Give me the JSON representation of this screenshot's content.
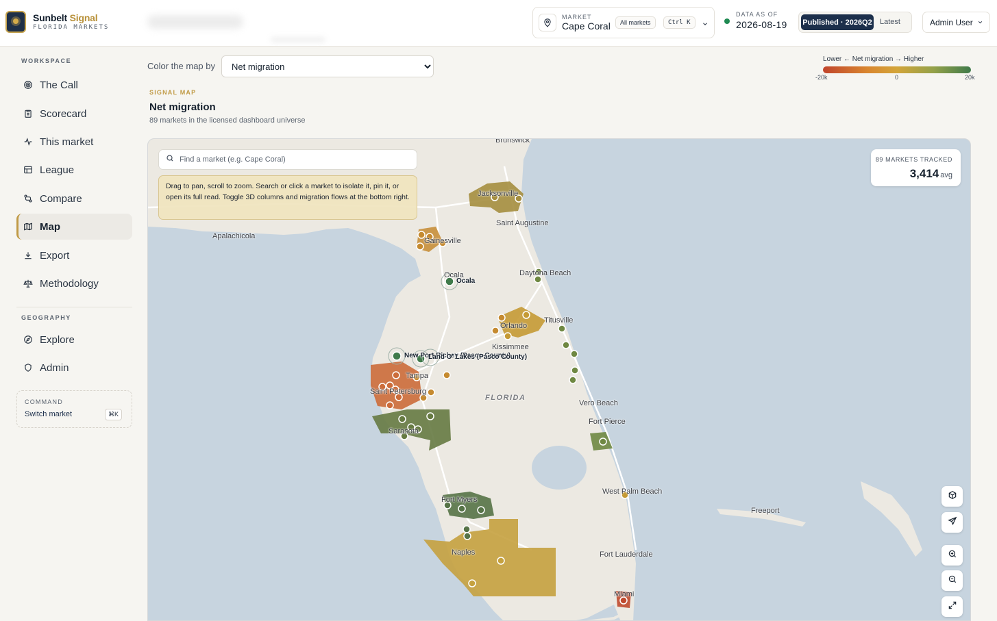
{
  "app": {
    "brand_primary": "Sunbelt",
    "brand_accent": "Signal",
    "brand_sub": "FLORIDA MARKETS"
  },
  "header": {
    "market_label": "MARKET",
    "market_value": "Cape Coral",
    "all_markets": "All markets",
    "shortcut": "Ctrl K",
    "data_as_of_label": "DATA AS OF",
    "data_as_of_value": "2026-08-19",
    "published": "Published · 2026Q2",
    "latest": "Latest",
    "user": "Admin User"
  },
  "sidebar": {
    "workspace_label": "WORKSPACE",
    "workspace_items": [
      {
        "label": "The Call",
        "icon": "target-icon"
      },
      {
        "label": "Scorecard",
        "icon": "clipboard-icon"
      },
      {
        "label": "This market",
        "icon": "activity-icon"
      },
      {
        "label": "League",
        "icon": "table-icon"
      },
      {
        "label": "Compare",
        "icon": "compare-icon"
      },
      {
        "label": "Map",
        "icon": "map-icon",
        "active": true
      },
      {
        "label": "Export",
        "icon": "download-icon"
      },
      {
        "label": "Methodology",
        "icon": "scale-icon"
      }
    ],
    "geography_label": "GEOGRAPHY",
    "geography_items": [
      {
        "label": "Explore",
        "icon": "compass-icon"
      },
      {
        "label": "Admin",
        "icon": "shield-icon"
      }
    ],
    "command": {
      "label": "COMMAND",
      "text": "Switch market",
      "kbd": "⌘K"
    }
  },
  "controls": {
    "color_by_label": "Color the map by",
    "color_by_value": "Net migration",
    "color_by_options": [
      "Net migration"
    ]
  },
  "legend": {
    "title": "Lower ← Net migration → Higher",
    "min": "-20k",
    "mid": "0",
    "max": "20k"
  },
  "panel": {
    "eyebrow": "SIGNAL MAP",
    "title": "Net migration",
    "subtitle": "89 markets in the licensed dashboard universe"
  },
  "map": {
    "search_placeholder": "Find a market (e.g. Cape Coral)",
    "hint": "Drag to pan, scroll to zoom. Search or click a market to isolate it, pin it, or open its full read. Toggle 3D columns and migration flows at the bottom right.",
    "tracked_label": "89 MARKETS TRACKED",
    "tracked_value": "3,414",
    "tracked_unit": "avg",
    "places": {
      "brunswick": "Brunswick",
      "jacksonville": "Jacksonville",
      "st_augustine": "Saint Augustine",
      "apalachicola": "Apalachicola",
      "gainesville": "Gainesville",
      "ocala": "Ocala",
      "ocala_bold": "Ocala",
      "daytona": "Daytona Beach",
      "titusville": "Titusville",
      "orlando": "Orlando",
      "kissimmee": "Kissimmee",
      "new_port_richey": "New Port Richey (Pasco County)",
      "land_o_lakes": "Land O' Lakes (Pasco County)",
      "tampa": "Tampa",
      "st_pete": "Saint Petersburg",
      "florida": "FLORIDA",
      "vero": "Vero Beach",
      "fort_pierce": "Fort Pierce",
      "sarasota": "Sarasota",
      "wpb": "West Palm Beach",
      "freeport": "Freeport",
      "fort_myers": "Fort Myers",
      "naples": "Naples",
      "fort_lauderdale": "Fort Lauderdale",
      "miami": "Miami"
    }
  },
  "colors": {
    "brand_navy": "#1c2f4b",
    "brand_gold": "#c09a45",
    "status_green": "#1f8a52",
    "water": "#c7d4df",
    "land": "#ece9e2"
  }
}
